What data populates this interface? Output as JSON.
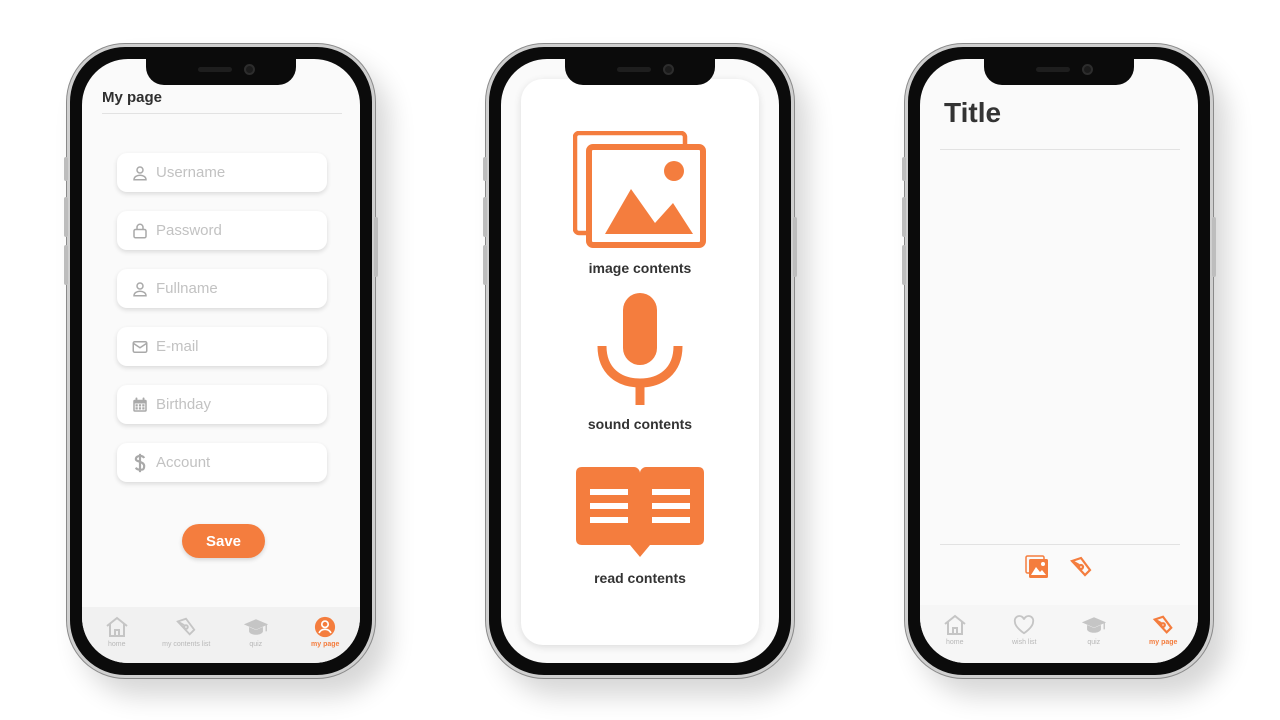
{
  "colors": {
    "accent": "#f47d3e",
    "inactive": "#b8b8b8"
  },
  "phone1": {
    "title": "My page",
    "fields": [
      {
        "icon": "user-icon",
        "placeholder": "Username"
      },
      {
        "icon": "lock-icon",
        "placeholder": "Password"
      },
      {
        "icon": "user-icon",
        "placeholder": "Fullname"
      },
      {
        "icon": "mail-icon",
        "placeholder": "E-mail"
      },
      {
        "icon": "calendar-icon",
        "placeholder": "Birthday"
      },
      {
        "icon": "dollar-icon",
        "placeholder": "Account"
      }
    ],
    "save_label": "Save",
    "tabs": [
      {
        "icon": "home-icon",
        "label": "home"
      },
      {
        "icon": "pen-nib-icon",
        "label": "my contents list"
      },
      {
        "icon": "graduation-cap-icon",
        "label": "quiz"
      },
      {
        "icon": "user-circle-icon",
        "label": "my page",
        "active": true
      }
    ]
  },
  "phone2": {
    "items": [
      {
        "icon": "image-gallery-icon",
        "label": "image contents"
      },
      {
        "icon": "microphone-icon",
        "label": "sound contents"
      },
      {
        "icon": "open-book-icon",
        "label": "read contents"
      }
    ]
  },
  "phone3": {
    "title": "Title",
    "actions": [
      {
        "icon": "image-gallery-icon"
      },
      {
        "icon": "pen-nib-icon"
      }
    ],
    "tabs": [
      {
        "icon": "home-icon",
        "label": "home"
      },
      {
        "icon": "heart-icon",
        "label": "wish list"
      },
      {
        "icon": "graduation-cap-icon",
        "label": "quiz"
      },
      {
        "icon": "pen-nib-icon",
        "label": "my page",
        "active": true
      }
    ]
  }
}
